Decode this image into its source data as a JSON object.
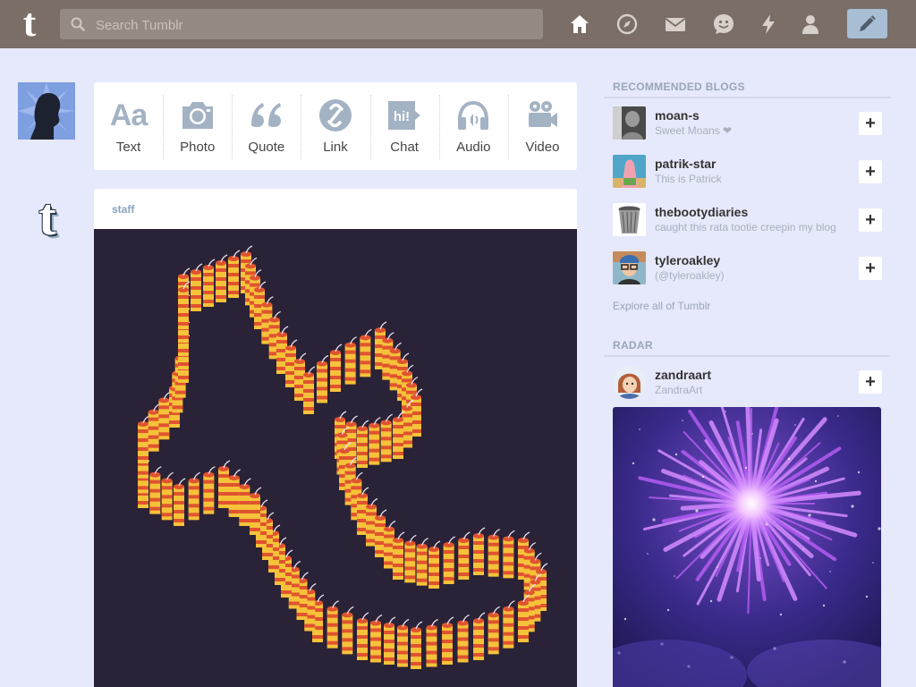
{
  "topbar": {
    "logo_letter": "t",
    "search_placeholder": "Search Tumblr",
    "nav_icons": [
      "home-icon",
      "explore-compass-icon",
      "inbox-mail-icon",
      "messaging-face-icon",
      "activity-lightning-icon",
      "account-person-icon"
    ],
    "compose_icon": "pencil-icon"
  },
  "post_types": [
    {
      "label": "Text",
      "icon": "text-aa-icon",
      "glyph": "Aa"
    },
    {
      "label": "Photo",
      "icon": "camera-icon"
    },
    {
      "label": "Quote",
      "icon": "quote-icon"
    },
    {
      "label": "Link",
      "icon": "link-icon"
    },
    {
      "label": "Chat",
      "icon": "chat-bubble-icon",
      "glyph": "hi!"
    },
    {
      "label": "Audio",
      "icon": "headphones-icon"
    },
    {
      "label": "Video",
      "icon": "video-camera-icon"
    }
  ],
  "post": {
    "author": "staff",
    "avatar_letter": "t"
  },
  "sidebar": {
    "recommended_heading": "RECOMMENDED BLOGS",
    "blogs": [
      {
        "name": "moan-s",
        "tagline": "Sweet Moans ❤"
      },
      {
        "name": "patrik-star",
        "tagline": "This is Patrick"
      },
      {
        "name": "thebootydiaries",
        "tagline": "caught this rata tootie creepin my blog"
      },
      {
        "name": "tyleroakley",
        "tagline": "(@tyleroakley)"
      }
    ],
    "explore_link": "Explore all of Tumblr",
    "radar_heading": "RADAR",
    "radar_blog": {
      "name": "zandraart",
      "tagline": "ZandraArt"
    },
    "follow_glyph": "+"
  },
  "colors": {
    "topbar": "#7a6e67",
    "background": "#e6e9fb",
    "compose_button": "#a8bed4",
    "post_image_bg": "#2a2236"
  }
}
